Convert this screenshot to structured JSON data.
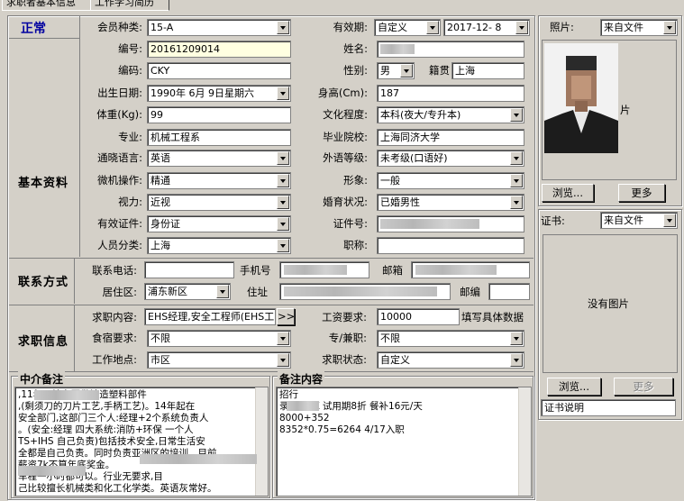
{
  "tabs": [
    "求职者基本信息",
    "工作学习简历"
  ],
  "status": "正常",
  "sections": {
    "basic": "基本资料",
    "contact": "联系方式",
    "job": "求职信息"
  },
  "labels": {
    "member_type": "会员种类:",
    "validity": "有效期:",
    "number": "编号:",
    "name": "姓名:",
    "code": "编码:",
    "gender": "性别:",
    "native": "籍贯",
    "birthdate": "出生日期:",
    "height": "身高(Cm):",
    "weight": "体重(Kg):",
    "education": "文化程度:",
    "major": "专业:",
    "school": "毕业院校:",
    "mandarin": "通晓语言:",
    "foreign_level": "外语等级:",
    "computer": "微机操作:",
    "appearance": "形象:",
    "vision": "视力:",
    "marital": "婚育状况:",
    "id_type": "有效证件:",
    "id_number": "证件号:",
    "category": "人员分类:",
    "title": "职称:",
    "phone": "联系电话:",
    "mobile": "手机号",
    "email": "邮箱",
    "district": "居住区:",
    "address": "住址",
    "postcode": "邮编",
    "position": "求职内容:",
    "salary": "工资要求:",
    "salary_hint": "填写具体数据",
    "board": "食宿要求:",
    "fulltime": "专/兼职:",
    "workplace": "工作地点:",
    "job_status": "求职状态:",
    "photo": "照片:",
    "certificate": "证书:"
  },
  "values": {
    "member_type": "15-A",
    "validity_type": "自定义",
    "validity_date": "2017-12- 8",
    "number": "20161209014",
    "code": "CKY",
    "gender": "男",
    "native": "上海",
    "birthdate": "1990年 6月 9日星期六",
    "height": "187",
    "weight": "99",
    "education": "本科(夜大/专升本)",
    "major": "机械工程系",
    "school": "上海同济大学",
    "mandarin": "英语",
    "foreign_level": "未考级(口语好)",
    "computer": "精通",
    "appearance": "一般",
    "vision": "近视",
    "marital": "已婚男性",
    "id_type": "身份证",
    "category": "上海",
    "district": "浦东新区",
    "position": "EHS经理,安全工程师(EHS工",
    "salary": "10000",
    "board": "不限",
    "fulltime": "不限",
    "workplace": "市区",
    "job_status": "自定义",
    "photo_source": "来自文件",
    "cert_source": "来自文件"
  },
  "buttons": {
    "more_arrow": ">>",
    "browse": "浏览...",
    "more": "更多",
    "browse2": "浏览...",
    "more2": "更多"
  },
  "photo_suffix": "片",
  "no_image": "没有图片",
  "cert_desc": "证书说明",
  "agent_notes": {
    "title": "中介备注",
    "lines": [
      ",11年开始主要做铸造塑料部件",
      ",(剩须刀的刀片工艺,手柄工艺)。14年起在",
      "安全部门,这部门三个人:经理+2个系统负责人",
      "。(安全:经理  四大系统:消防+环保 一个人",
      " TS+IHS 自己负责)包括技术安全,日常生活安",
      "全都是自己负责。同时负责亚洲区的培训。目前",
      "薪资7k不算年底奖金。",
      "车程一小时都可以。行业无要求,目",
      "己比较擅长机械类和化工化学类。英语灰常好。"
    ]
  },
  "remarks": {
    "title": "备注内容",
    "lines": [
      "招行",
      "录用  10K 试用期8折 餐补16元/天",
      "8000+352",
      "8352*0.75=6264   4/17入职"
    ]
  }
}
